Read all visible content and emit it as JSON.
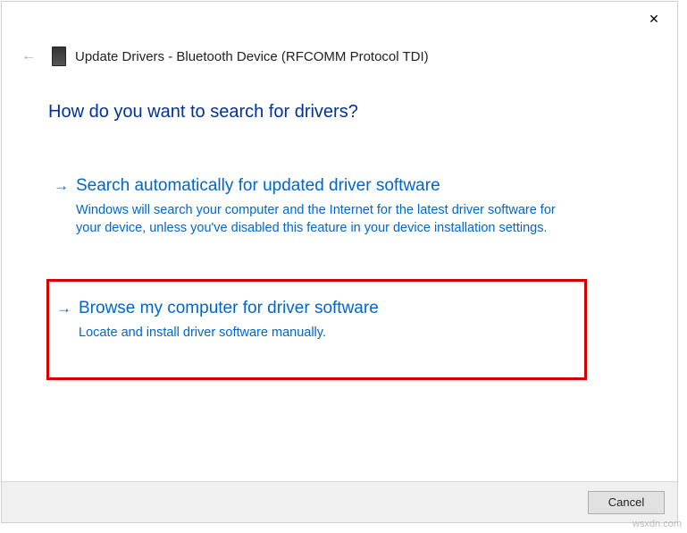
{
  "window": {
    "title": "Update Drivers - Bluetooth Device (RFCOMM Protocol TDI)"
  },
  "heading": "How do you want to search for drivers?",
  "options": {
    "auto": {
      "title": "Search automatically for updated driver software",
      "desc": "Windows will search your computer and the Internet for the latest driver software for your device, unless you've disabled this feature in your device installation settings."
    },
    "browse": {
      "title": "Browse my computer for driver software",
      "desc": "Locate and install driver software manually."
    }
  },
  "footer": {
    "cancel": "Cancel"
  },
  "watermark": "wsxdn.com"
}
